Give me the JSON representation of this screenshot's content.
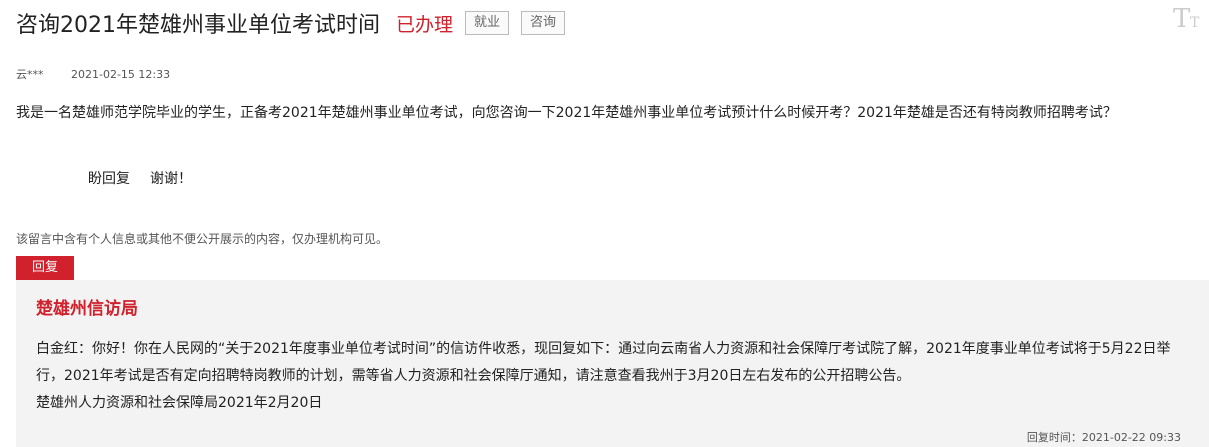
{
  "header": {
    "title": "咨询2021年楚雄州事业单位考试时间",
    "status": "已办理",
    "tags": [
      "就业",
      "咨询"
    ],
    "font_size_icon": "font-size-icon"
  },
  "meta": {
    "author": "云***",
    "time": "2021-02-15 12:33"
  },
  "question": {
    "body": "我是一名楚雄师范学院毕业的学生，正备考2021年楚雄州事业单位考试，向您咨询一下2021年楚雄州事业单位考试预计什么时候开考？2021年楚雄是否还有特岗教师招聘考试？",
    "closing": "盼回复",
    "thanks": "谢谢！"
  },
  "privacy_note": "该留言中含有个人信息或其他不便公开展示的内容，仅办理机构可见。",
  "reply": {
    "tab_label": "回复",
    "org": "楚雄州信访局",
    "body": "白金红：你好！你在人民网的“关于2021年度事业单位考试时间”的信访件收悉，现回复如下：通过向云南省人力资源和社会保障厅考试院了解，2021年度事业单位考试将于5月22日举行，2021年考试是否有定向招聘特岗教师的计划，需等省人力资源和社会保障厅通知，请注意查看我州于3月20日左右发布的公开招聘公告。",
    "signature": "楚雄州人力资源和社会保障局2021年2月20日",
    "time_label": "回复时间：",
    "time": "2021-02-22 09:33"
  },
  "colors": {
    "accent_red": "#d0212d",
    "reply_bg": "#f3f3f3"
  }
}
